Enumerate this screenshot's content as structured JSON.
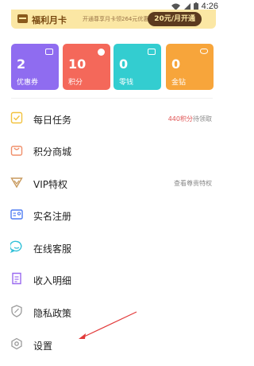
{
  "status_bar": {
    "time": "4:26"
  },
  "banner": {
    "title": "福利月卡",
    "description": "开通尊享月卡领264元优惠券",
    "button": "20元/月开通"
  },
  "assets": [
    {
      "value": "2",
      "label": "优惠券",
      "color": "#8f6cf0",
      "icon": "coupon-icon"
    },
    {
      "value": "10",
      "label": "积分",
      "color": "#f4685a",
      "icon": "points-icon"
    },
    {
      "value": "0",
      "label": "零钱",
      "color": "#33cdd0",
      "icon": "wallet-icon"
    },
    {
      "value": "0",
      "label": "金钻",
      "color": "#f7a53b",
      "icon": "diamond-icon"
    }
  ],
  "menu": [
    {
      "label": "每日任务",
      "extra_highlight": "440积分",
      "extra": "待领取",
      "icon": "checkbox-icon",
      "color": "#f2c23e"
    },
    {
      "label": "积分商城",
      "extra_highlight": "",
      "extra": "",
      "icon": "shopping-bag-icon",
      "color": "#f08f6a"
    },
    {
      "label": "VIP特权",
      "extra_highlight": "",
      "extra": "查看尊贵特权",
      "icon": "vip-crown-icon",
      "color": "#c89a5e"
    },
    {
      "label": "实名注册",
      "extra_highlight": "",
      "extra": "",
      "icon": "id-card-icon",
      "color": "#4e7cf2"
    },
    {
      "label": "在线客服",
      "extra_highlight": "",
      "extra": "",
      "icon": "chat-bubble-icon",
      "color": "#2fc0d8"
    },
    {
      "label": "收入明细",
      "extra_highlight": "",
      "extra": "",
      "icon": "document-list-icon",
      "color": "#9b6af0"
    },
    {
      "label": "隐私政策",
      "extra_highlight": "",
      "extra": "",
      "icon": "shield-icon",
      "color": "#9a9a9a"
    },
    {
      "label": "设置",
      "extra_highlight": "",
      "extra": "",
      "icon": "settings-hexagon-icon",
      "color": "#9a9a9a"
    }
  ],
  "annotation": {
    "arrow_color": "#e23a3a"
  }
}
